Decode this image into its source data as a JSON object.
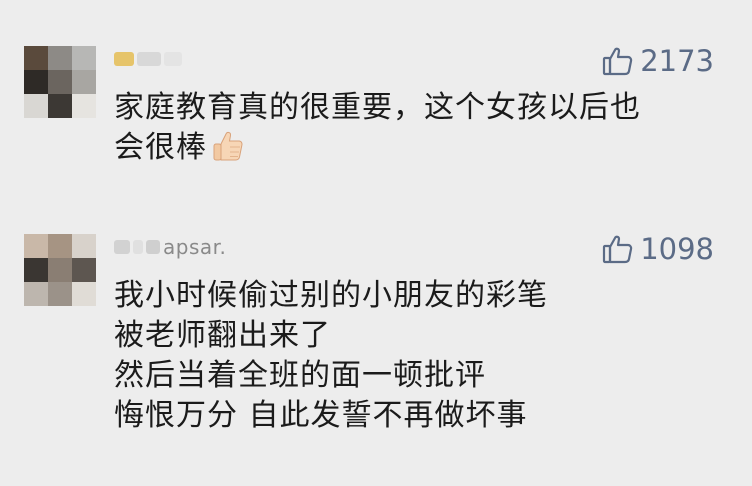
{
  "comments": [
    {
      "username": "",
      "likes": "2173",
      "lines": [
        "家庭教育真的很重要，这个女孩以后也",
        "会很棒"
      ],
      "trailing_emoji": "thumbs-up-emoji"
    },
    {
      "username": "apsar.",
      "likes": "1098",
      "lines": [
        "我小时候偷过别的小朋友的彩笔",
        "被老师翻出来了",
        "然后当着全班的面一顿批评",
        "悔恨万分 自此发誓不再做坏事"
      ]
    }
  ],
  "colors": {
    "background": "#ededed",
    "like_accent": "#5b6b86",
    "text": "#1b1b1b"
  }
}
